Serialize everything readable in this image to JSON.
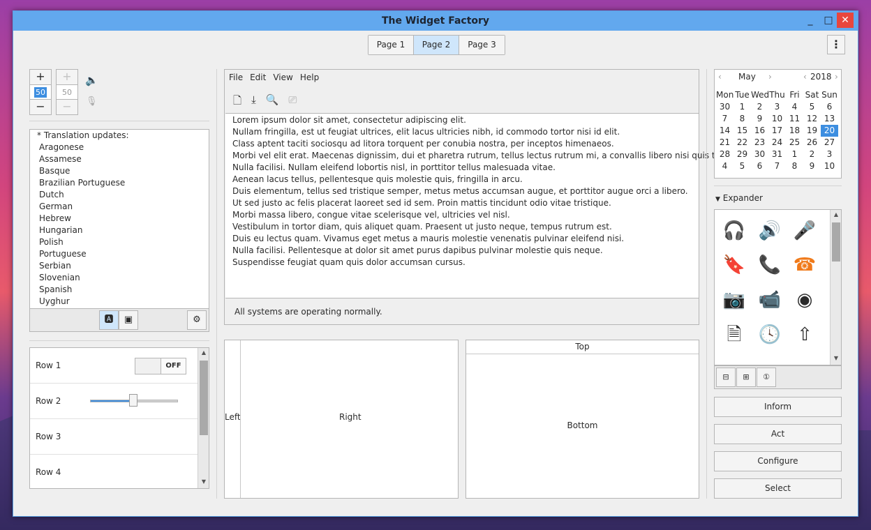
{
  "window": {
    "title": "The Widget Factory",
    "min": "_",
    "max": "□",
    "close": "✕"
  },
  "tabs": [
    {
      "label": "Page 1"
    },
    {
      "label": "Page 2"
    },
    {
      "label": "Page 3"
    }
  ],
  "menu_button": "⋮",
  "spins": {
    "plus": "+",
    "minus": "−",
    "value": "50",
    "value2": "50"
  },
  "icons": {
    "speaker": "🔈",
    "mic": "🎙"
  },
  "languages": {
    "header": "* Translation updates:",
    "items": [
      "Aragonese",
      "Assamese",
      "Basque",
      "Brazilian Portuguese",
      "Dutch",
      "German",
      "Hebrew",
      "Hungarian",
      "Polish",
      "Portuguese",
      "Serbian",
      "Slovenian",
      "Spanish",
      "Uyghur"
    ]
  },
  "rows": [
    {
      "label": "Row 1"
    },
    {
      "label": "Row 2"
    },
    {
      "label": "Row 3"
    },
    {
      "label": "Row 4"
    }
  ],
  "switch": {
    "label": "OFF",
    "on": false
  },
  "slider": {
    "value": 0.5
  },
  "editor": {
    "menu": [
      "File",
      "Edit",
      "View",
      "Help"
    ],
    "lines": [
      "Lorem ipsum dolor sit amet, consectetur adipiscing elit.",
      "Nullam fringilla, est ut feugiat ultrices, elit lacus ultricies nibh, id commodo tortor nisi id elit.",
      "Class aptent taciti sociosqu ad litora torquent per conubia nostra, per inceptos himenaeos.",
      "Morbi vel elit erat. Maecenas dignissim, dui et pharetra rutrum, tellus lectus rutrum mi, a convallis libero nisi quis tellus.",
      "Nulla facilisi. Nullam eleifend lobortis nisl, in porttitor tellus malesuada vitae.",
      "Aenean lacus tellus, pellentesque quis molestie quis, fringilla in arcu.",
      "Duis elementum, tellus sed tristique semper, metus metus accumsan augue, et porttitor augue orci a libero.",
      "Ut sed justo ac felis placerat laoreet sed id sem. Proin mattis tincidunt odio vitae tristique.",
      "Morbi massa libero, congue vitae scelerisque vel, ultricies vel nisl.",
      "Vestibulum in tortor diam, quis aliquet quam. Praesent ut justo neque, tempus rutrum est.",
      "Duis eu lectus quam. Vivamus eget metus a mauris molestie venenatis pulvinar eleifend nisi.",
      "Nulla facilisi. Pellentesque at dolor sit amet purus dapibus pulvinar molestie quis neque.",
      "Suspendisse feugiat quam quis dolor accumsan cursus."
    ],
    "status": "All systems are operating normally."
  },
  "paned": {
    "left": "Left",
    "right": "Right",
    "top": "Top",
    "bottom": "Bottom"
  },
  "calendar": {
    "month": "May",
    "year": "2018",
    "days": [
      "Mon",
      "Tue",
      "Wed",
      "Thu",
      "Fri",
      "Sat",
      "Sun"
    ],
    "weeks": [
      [
        "30",
        "1",
        "2",
        "3",
        "4",
        "5",
        "6"
      ],
      [
        "7",
        "8",
        "9",
        "10",
        "11",
        "12",
        "13"
      ],
      [
        "14",
        "15",
        "16",
        "17",
        "18",
        "19",
        "20"
      ],
      [
        "21",
        "22",
        "23",
        "24",
        "25",
        "26",
        "27"
      ],
      [
        "28",
        "29",
        "30",
        "31",
        "1",
        "2",
        "3"
      ],
      [
        "4",
        "5",
        "6",
        "7",
        "8",
        "9",
        "10"
      ]
    ],
    "selected": "20"
  },
  "expander": {
    "label": "Expander"
  },
  "buttons": {
    "inform": "Inform",
    "act": "Act",
    "configure": "Configure",
    "select": "Select"
  },
  "colors": {
    "accent": "#3d8ee0",
    "title_bar": "#62a8ee",
    "close": "#e8463e",
    "orange": "#f07a1a"
  }
}
